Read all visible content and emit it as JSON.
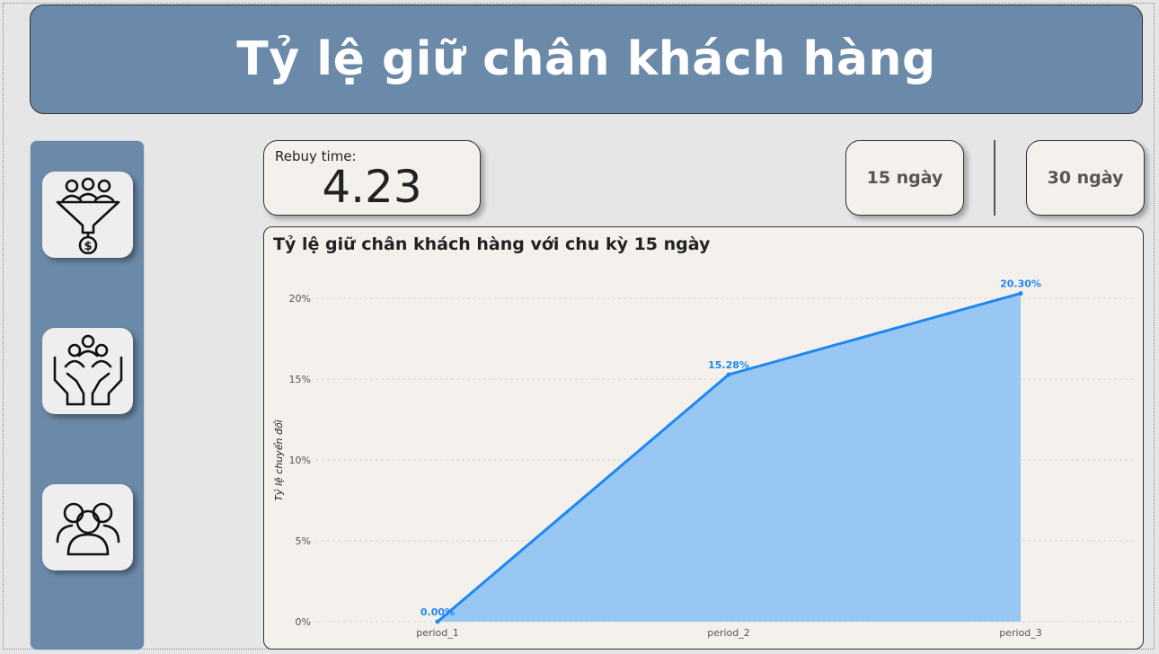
{
  "header": {
    "title": "Tỷ lệ giữ chân khách hàng"
  },
  "sidebar": {
    "items": [
      {
        "icon": "funnel-money-icon"
      },
      {
        "icon": "hands-people-icon"
      },
      {
        "icon": "customer-group-icon"
      }
    ]
  },
  "kpi": {
    "label": "Rebuy time:",
    "value": "4.23"
  },
  "period_toggle": {
    "option_15": "15 ngày",
    "option_30": "30 ngày"
  },
  "chart": {
    "title": "Tỷ lệ giữ chân khách hàng với chu kỳ 15 ngày"
  },
  "colors": {
    "banner": "#6b89a8",
    "line": "#1e88f0",
    "area": "#99c7f3",
    "card": "#f4f1ed"
  },
  "chart_data": {
    "type": "area",
    "title": "Tỷ lệ giữ chân khách hàng với chu kỳ 15 ngày",
    "xlabel": "",
    "ylabel": "Tỷ lệ chuyển đổi",
    "categories": [
      "period_1",
      "period_2",
      "period_3"
    ],
    "values": [
      0.0,
      15.28,
      20.3
    ],
    "data_labels": [
      "0.00%",
      "15.28%",
      "20.30%"
    ],
    "yticks": [
      "0%",
      "5%",
      "10%",
      "15%",
      "20%"
    ],
    "ytick_values": [
      0,
      5,
      10,
      15,
      20
    ],
    "ylim": [
      0,
      20.3
    ],
    "grid": true,
    "legend": "none"
  }
}
